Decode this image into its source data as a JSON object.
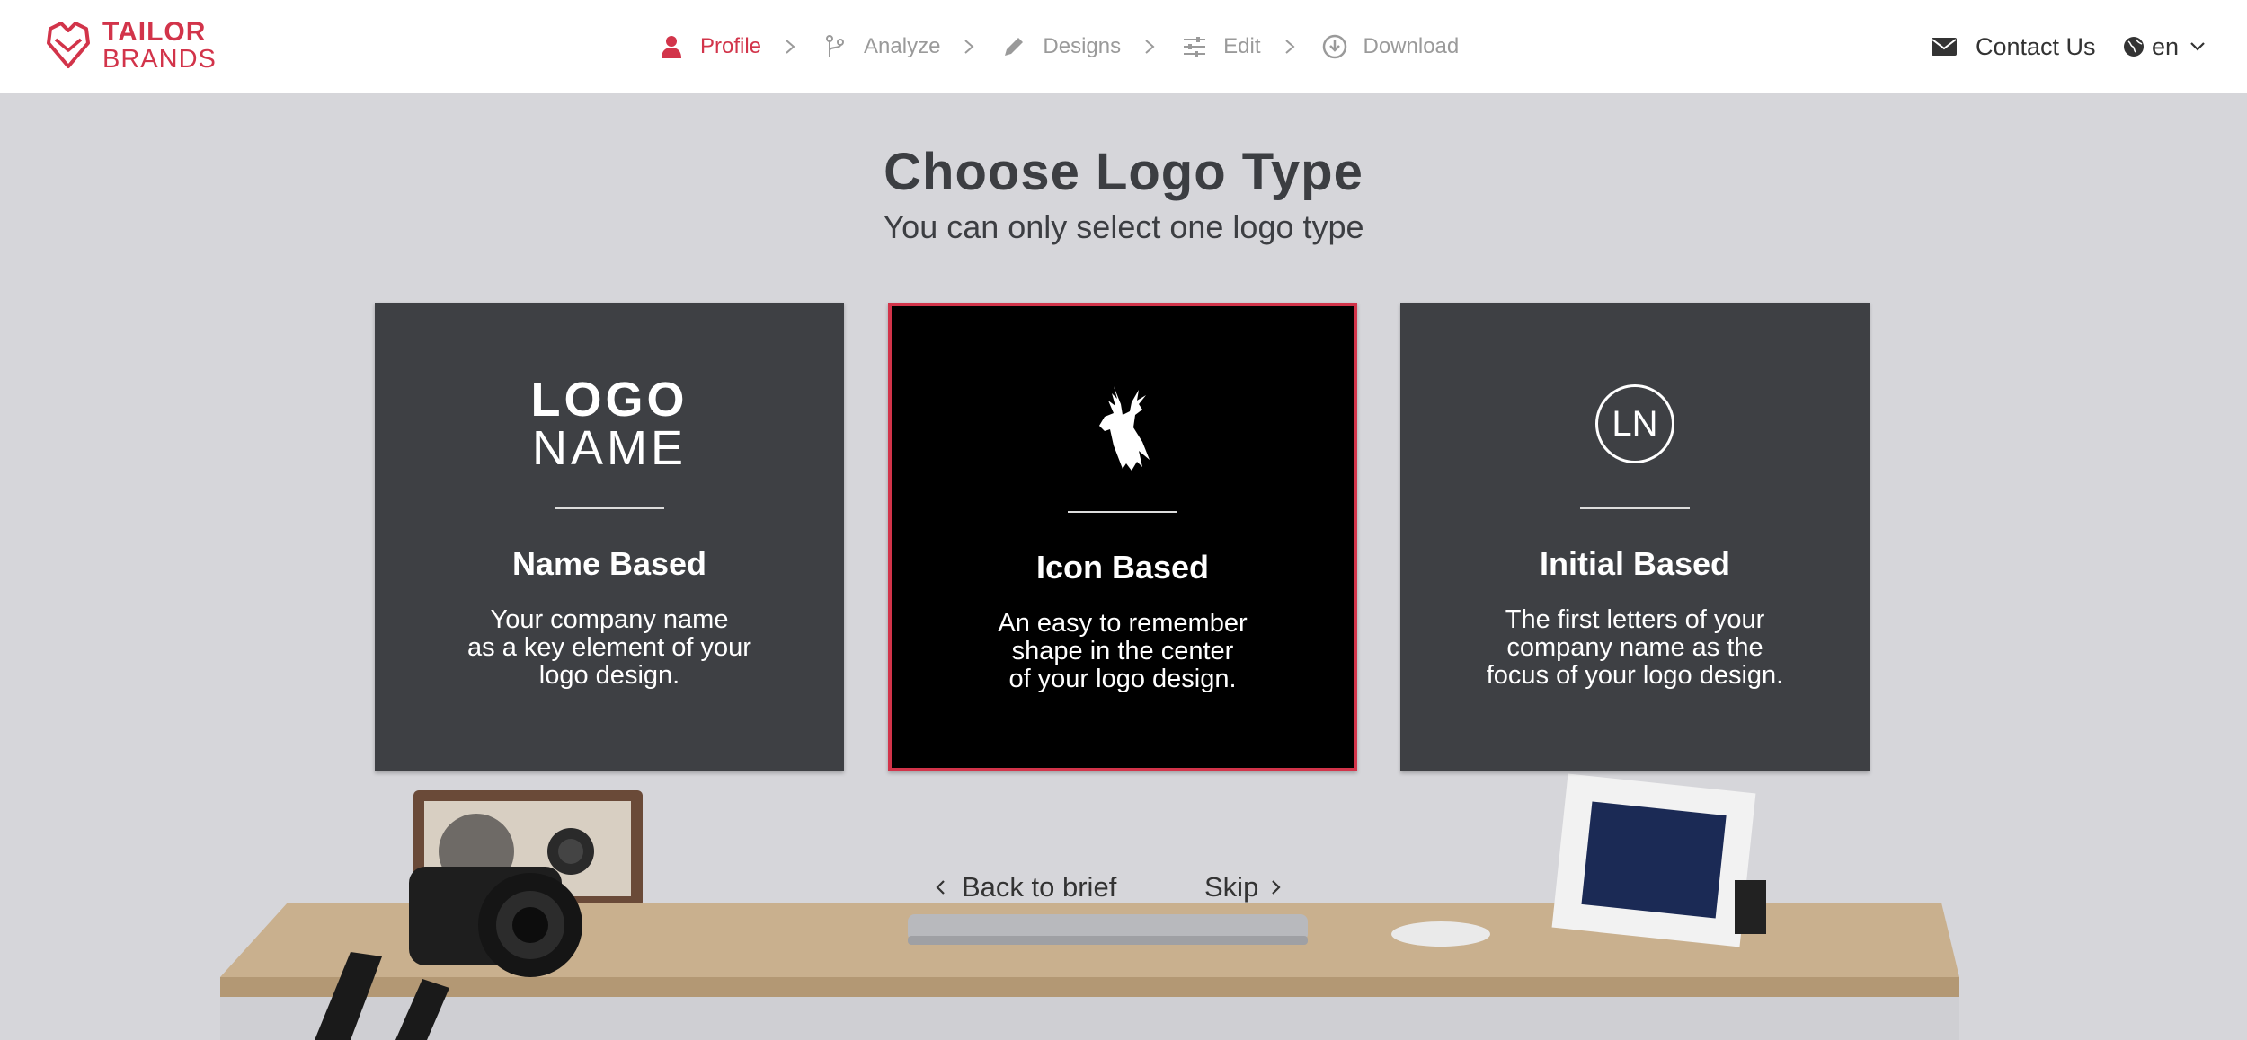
{
  "brand": {
    "line1": "TAILOR",
    "line2": "BRANDS",
    "color": "#d2344a"
  },
  "steps": [
    {
      "label": "Profile",
      "icon": "user-icon",
      "active": true
    },
    {
      "label": "Analyze",
      "icon": "branch-icon",
      "active": false
    },
    {
      "label": "Designs",
      "icon": "pencil-icon",
      "active": false
    },
    {
      "label": "Edit",
      "icon": "sliders-icon",
      "active": false
    },
    {
      "label": "Download",
      "icon": "download-icon",
      "active": false
    }
  ],
  "header_right": {
    "contact_label": "Contact Us",
    "contact_icon": "envelope-icon",
    "language": "en",
    "language_icon": "globe-icon"
  },
  "page": {
    "title": "Choose Logo Type",
    "subtitle": "You can only select one logo type"
  },
  "cards": [
    {
      "visual_line1": "LOGO",
      "visual_line2": "NAME",
      "title": "Name Based",
      "description": "Your company name\nas a key element of your\nlogo design.",
      "selected": false
    },
    {
      "visual_icon": "deer-head-icon",
      "title": "Icon Based",
      "description": "An easy to remember\nshape in the center\nof your logo design.",
      "selected": true
    },
    {
      "visual_text": "LN",
      "title": "Initial Based",
      "description": "The first letters of your\ncompany name as the\nfocus of your logo design.",
      "selected": false
    }
  ],
  "nav": {
    "back_label": "Back to brief",
    "skip_label": "Skip"
  },
  "colors": {
    "accent": "#d2344a",
    "card_bg": "#3e4044",
    "selected_bg": "#000000",
    "page_bg": "#d6d6da"
  }
}
